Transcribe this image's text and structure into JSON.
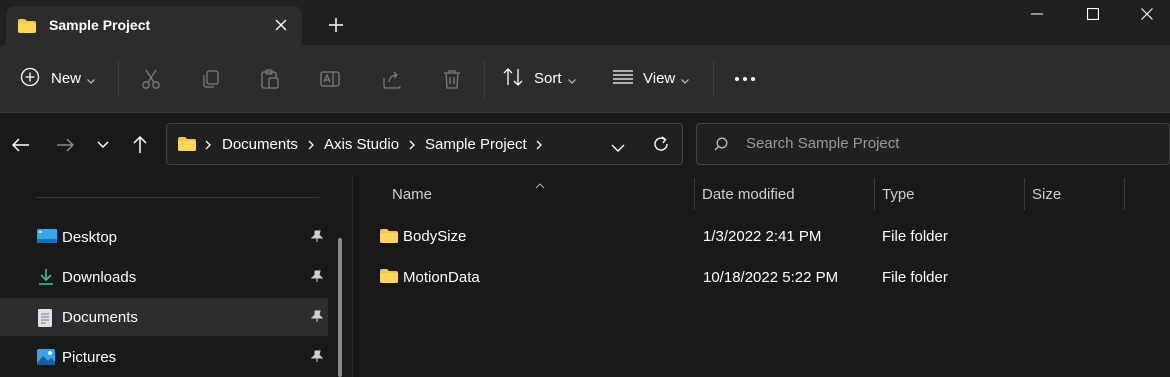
{
  "tab": {
    "title": "Sample Project",
    "folder_icon": "folder-icon",
    "close_icon": "close-icon"
  },
  "new_tab_icon": "plus-icon",
  "window_controls": [
    "minimize-icon",
    "maximize-icon",
    "close-icon"
  ],
  "toolbar": {
    "new_label": "New",
    "sort_label": "Sort",
    "view_label": "View",
    "icons": [
      "cut-icon",
      "copy-icon",
      "paste-icon",
      "rename-icon",
      "share-icon",
      "delete-icon",
      "more-icon"
    ]
  },
  "address": {
    "crumbs": [
      "Documents",
      "Axis Studio",
      "Sample Project"
    ]
  },
  "search": {
    "placeholder": "Search Sample Project"
  },
  "sidebar": {
    "items": [
      {
        "label": "Desktop",
        "icon": "desktop-icon",
        "pinned": true,
        "selected": false
      },
      {
        "label": "Downloads",
        "icon": "download-icon",
        "pinned": true,
        "selected": false
      },
      {
        "label": "Documents",
        "icon": "document-icon",
        "pinned": true,
        "selected": true
      },
      {
        "label": "Pictures",
        "icon": "pictures-icon",
        "pinned": true,
        "selected": false
      }
    ]
  },
  "file_list": {
    "columns": [
      "Name",
      "Date modified",
      "Type",
      "Size"
    ],
    "rows": [
      {
        "name": "BodySize",
        "date": "1/3/2022 2:41 PM",
        "type": "File folder",
        "size": ""
      },
      {
        "name": "MotionData",
        "date": "10/18/2022 5:22 PM",
        "type": "File folder",
        "size": ""
      }
    ]
  },
  "colors": {
    "folder": "#f8c644",
    "background": "#191919",
    "toolbar": "#2c2c2c",
    "accent_blue": "#4cc2ff"
  }
}
